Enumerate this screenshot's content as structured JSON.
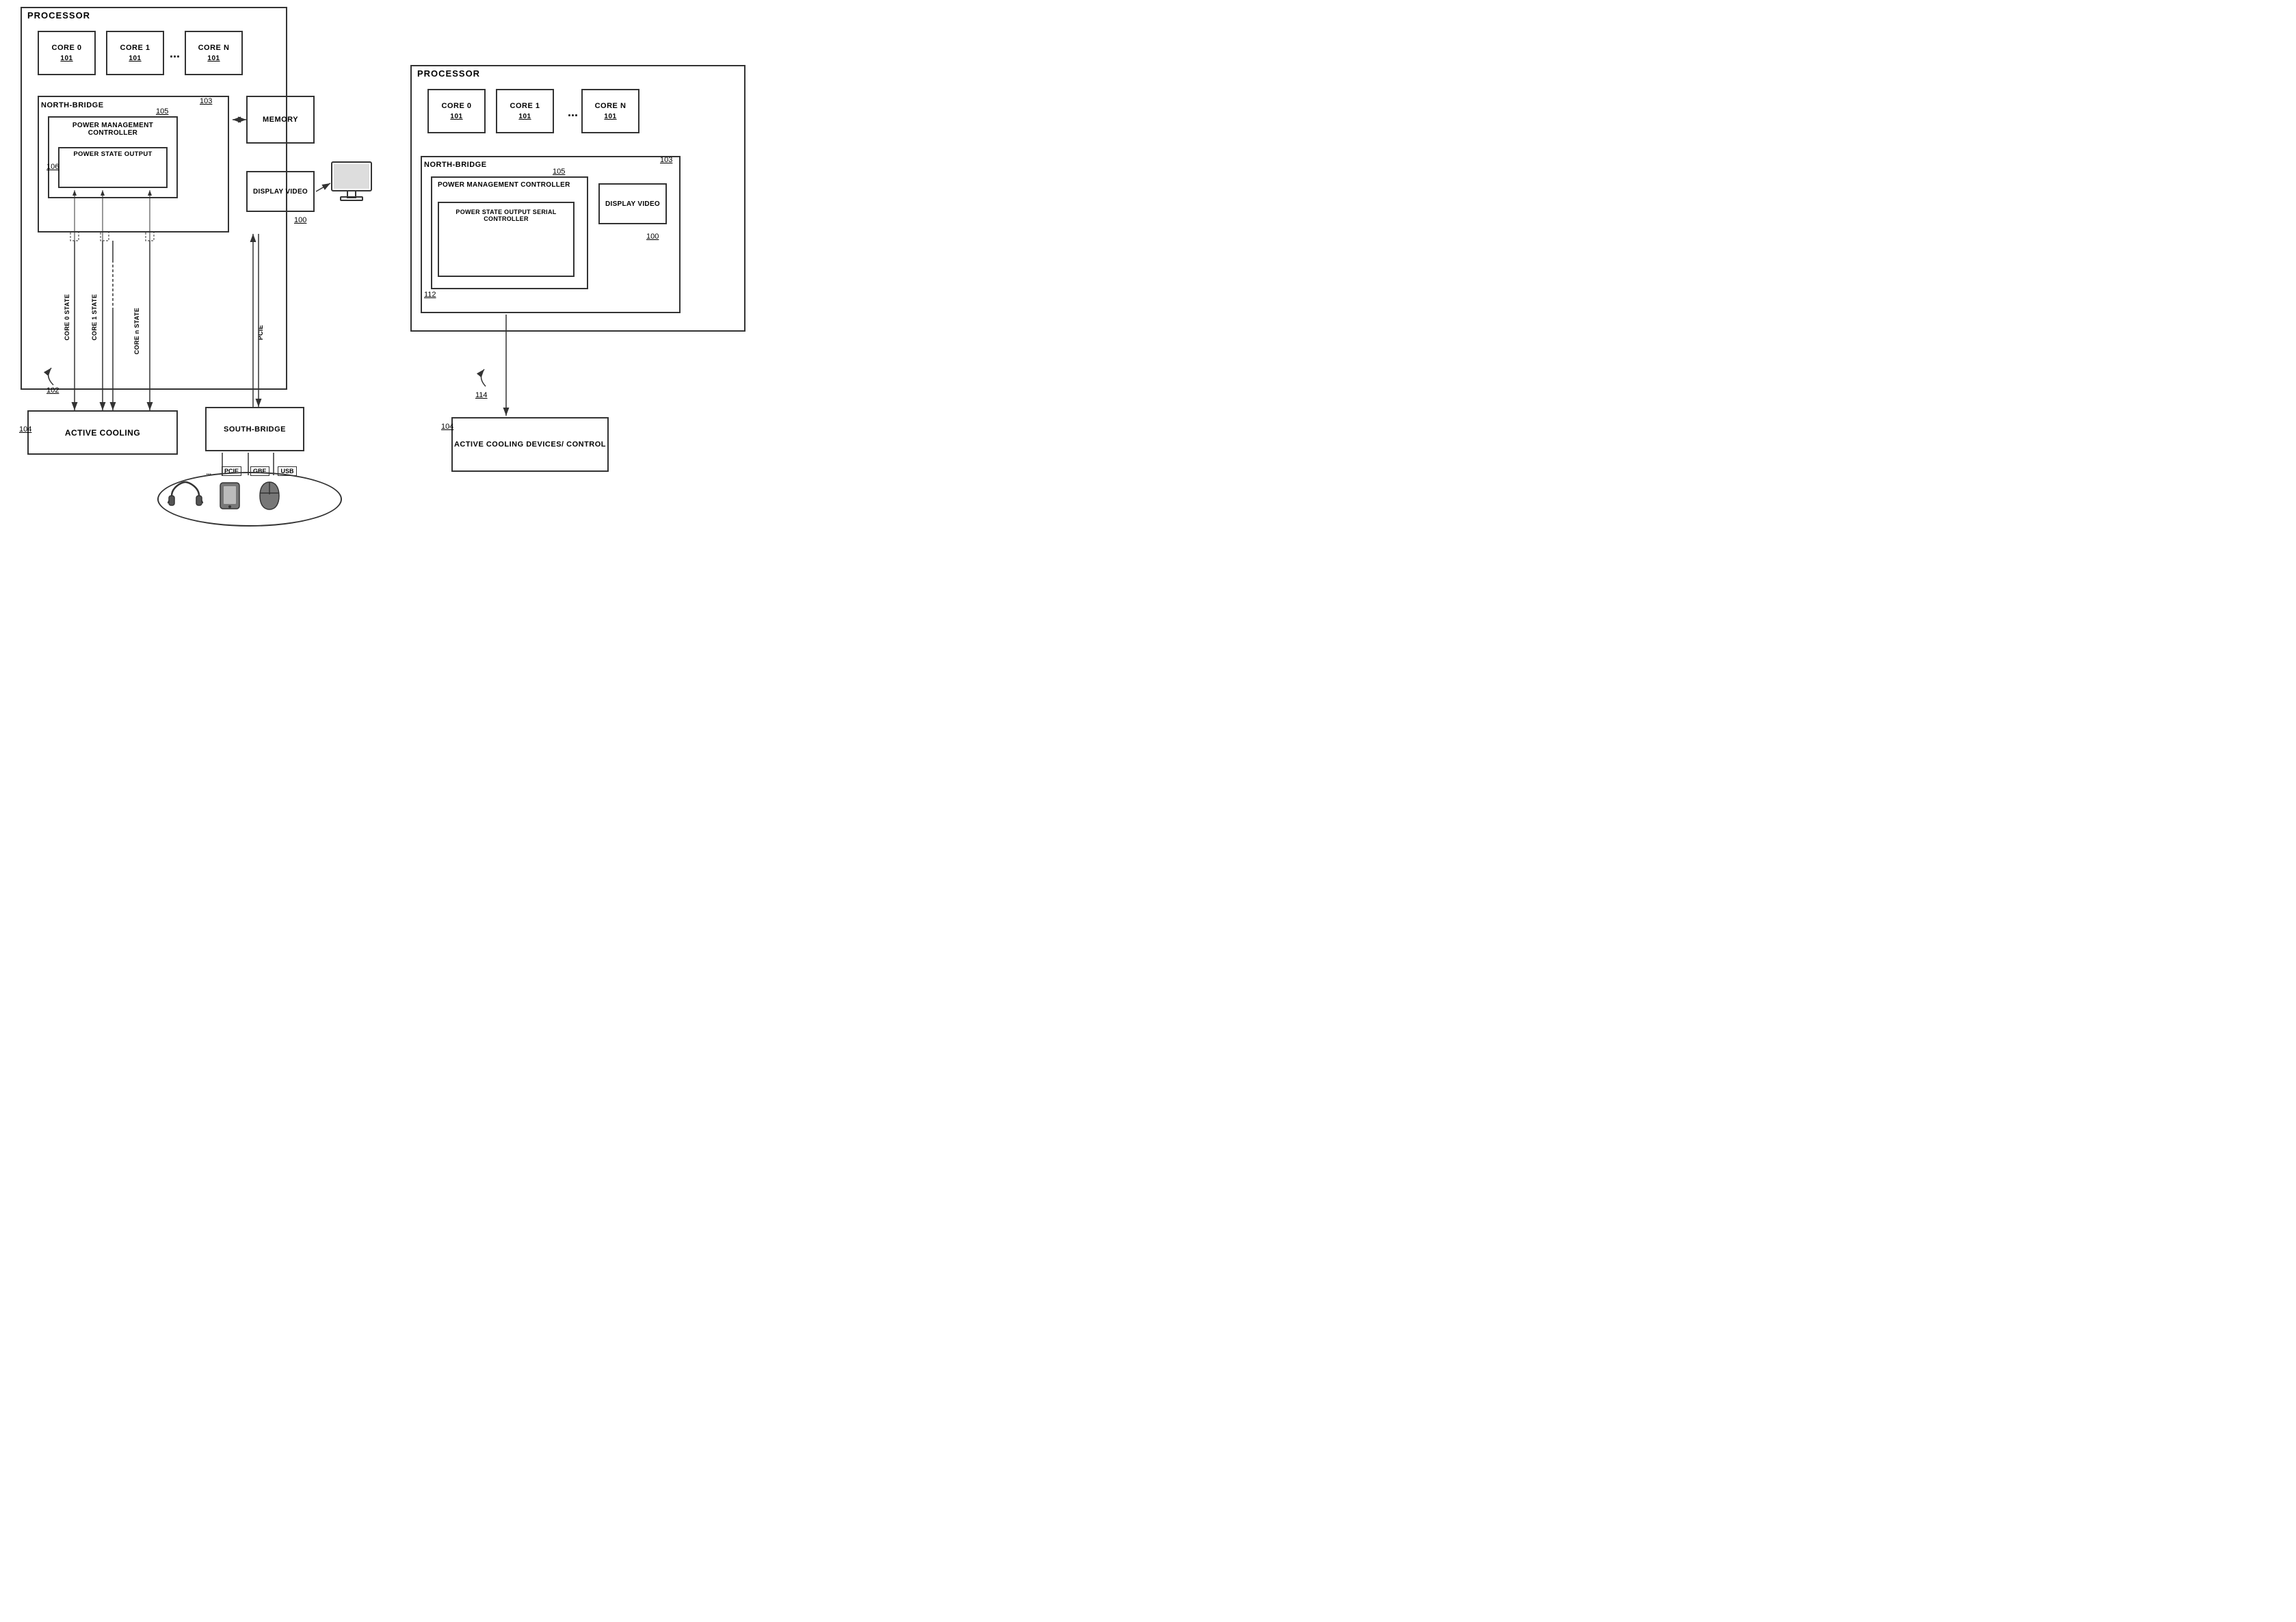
{
  "left_diagram": {
    "processor_label": "PROCESSOR",
    "core0_label": "CORE 0",
    "core0_ref": "101",
    "core1_label": "CORE 1",
    "core1_ref": "101",
    "coren_label": "CORE N",
    "coren_ref": "101",
    "dots": "...",
    "nb_label": "NORTH-BRIDGE",
    "nb_ref": "103",
    "nb_ref2": "105",
    "pmc_label": "POWER MANAGEMENT CONTROLLER",
    "pso_label": "POWER STATE OUTPUT",
    "pso_ref": "106",
    "memory_label": "MEMORY",
    "dv_label": "DISPLAY VIDEO",
    "dv_ref": "100",
    "pcie_label": "PCIE",
    "core0_state": "CORE 0 STATE",
    "core1_state": "CORE 1 STATE",
    "coren_state": "CORE n STATE",
    "ac_label": "ACTIVE COOLING",
    "ac_ref": "104",
    "ac_ref2": "102",
    "sb_label": "SOUTH-BRIDGE",
    "bus_pcie": "PCIE",
    "bus_gbe": "GBE",
    "bus_usb": "USB",
    "bus_dots": "..."
  },
  "right_diagram": {
    "processor_label": "PROCESSOR",
    "core0_label": "CORE 0",
    "core0_ref": "101",
    "core1_label": "CORE 1",
    "core1_ref": "101",
    "coren_label": "CORE N",
    "coren_ref": "101",
    "dots": "...",
    "nb_label": "NORTH-BRIDGE",
    "nb_ref": "103",
    "nb_ref2": "105",
    "nb_ref3": "112",
    "pmc_label": "POWER MANAGEMENT CONTROLLER",
    "pso_serial_label": "POWER STATE OUTPUT SERIAL CONTROLLER",
    "dv_label": "DISPLAY VIDEO",
    "dv_ref": "100",
    "acd_label": "ACTIVE COOLING DEVICES/ CONTROL",
    "acd_ref": "104",
    "arrow_ref": "114"
  }
}
